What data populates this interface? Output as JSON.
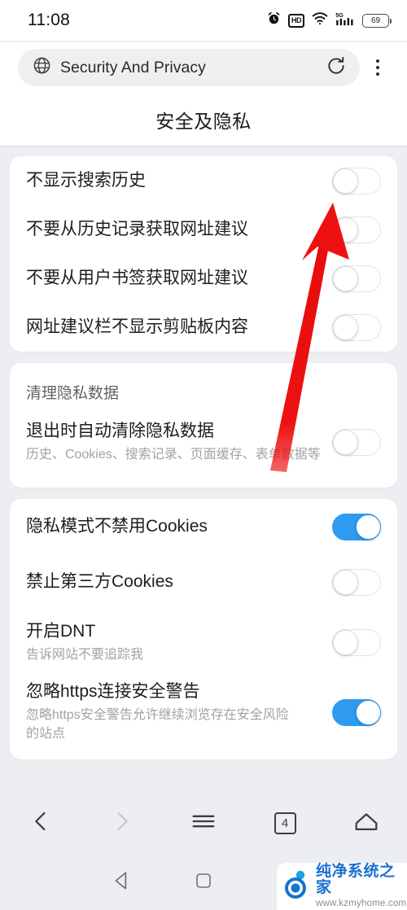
{
  "statusbar": {
    "time": "11:08",
    "battery_level": "69",
    "icons": [
      "alarm-icon",
      "hd-icon",
      "wifi-icon",
      "signal-5g-icon",
      "battery-icon"
    ],
    "hd_label": "HD",
    "network_label": "5G"
  },
  "addressbar": {
    "globe_icon": "globe-icon",
    "url_text": "Security And Privacy",
    "reload_icon": "reload-icon",
    "menu_icon": "kebab-menu-icon"
  },
  "page": {
    "title": "安全及隐私"
  },
  "colors": {
    "accent_blue": "#2e9bf0",
    "page_background": "#eceef2",
    "card_background": "#ffffff",
    "primary_text": "#1d1d1d",
    "secondary_text": "#a0a2a6",
    "annotation_red": "#ee1111"
  },
  "cards": [
    {
      "name": "search-suggestion-card",
      "group_title": null,
      "rows": [
        {
          "title": "不显示搜索历史",
          "sub": null,
          "toggle": "off"
        },
        {
          "title": "不要从历史记录获取网址建议",
          "sub": null,
          "toggle": "off"
        },
        {
          "title": "不要从用户书签获取网址建议",
          "sub": null,
          "toggle": "off"
        },
        {
          "title": "网址建议栏不显示剪贴板内容",
          "sub": null,
          "toggle": "off"
        }
      ]
    },
    {
      "name": "clear-privacy-data-card",
      "group_title": "清理隐私数据",
      "rows": [
        {
          "title": "退出时自动清除隐私数据",
          "sub": "历史、Cookies、搜索记录、页面缓存、表单数据等",
          "toggle": "off"
        }
      ]
    },
    {
      "name": "cookies-security-card",
      "group_title": null,
      "rows": [
        {
          "title": "隐私模式不禁用Cookies",
          "sub": null,
          "toggle": "on"
        },
        {
          "title": "禁止第三方Cookies",
          "sub": null,
          "toggle": "off"
        },
        {
          "title": "开启DNT",
          "sub": "告诉网站不要追踪我",
          "toggle": "off"
        },
        {
          "title": "忽略https连接安全警告",
          "sub": "忽略https安全警告允许继续浏览存在安全风险的站点",
          "toggle": "on"
        }
      ]
    }
  ],
  "browser_bar": {
    "items": [
      {
        "name": "back-icon",
        "label": "后退",
        "state": "enabled"
      },
      {
        "name": "forward-icon",
        "label": "前进",
        "state": "disabled"
      },
      {
        "name": "menu-icon",
        "label": "菜单",
        "state": "enabled"
      },
      {
        "name": "tab-count-icon",
        "label": "4",
        "state": "enabled"
      },
      {
        "name": "home-icon",
        "label": "主页",
        "state": "enabled"
      }
    ],
    "tab_count": "4"
  },
  "android_nav": {
    "items": [
      {
        "name": "nav-back-icon",
        "label": "返回"
      },
      {
        "name": "nav-home-icon",
        "label": "主页"
      }
    ]
  },
  "annotation": {
    "type": "arrow",
    "points_to": "不显示搜索历史 toggle",
    "color": "#ee1111"
  },
  "watermark": {
    "site_name": "纯净系统之家",
    "site_url": "www.kzmyhome.com"
  }
}
